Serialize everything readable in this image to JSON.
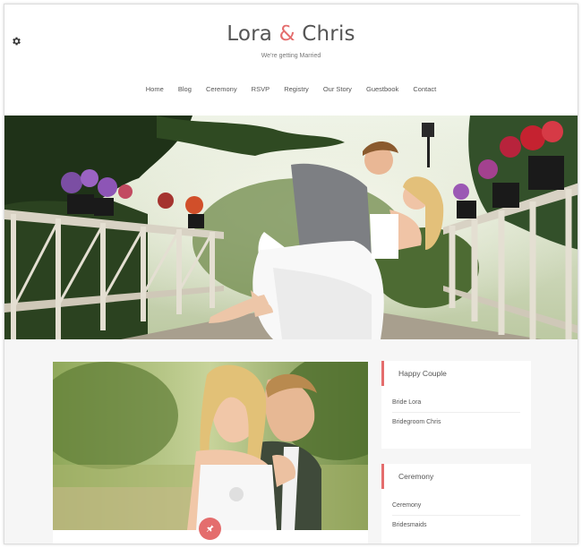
{
  "header": {
    "title_part1": "Lora",
    "title_amp": "&",
    "title_part2": "Chris",
    "tagline": "We're getting Married"
  },
  "nav": {
    "items": [
      "Home",
      "Blog",
      "Ceremony",
      "RSVP",
      "Registry",
      "Our Story",
      "Guestbook",
      "Contact"
    ]
  },
  "sidebar": {
    "widgets": [
      {
        "title": "Happy Couple",
        "items": [
          "Bride Lora",
          "Bridegroom Chris"
        ]
      },
      {
        "title": "Ceremony",
        "items": [
          "Ceremony",
          "Bridesmaids"
        ]
      }
    ]
  },
  "colors": {
    "accent": "#e46d6d",
    "text": "#555555",
    "content_bg": "#f6f6f6"
  },
  "icons": {
    "settings": "gear-icon",
    "pin": "pin-icon"
  }
}
